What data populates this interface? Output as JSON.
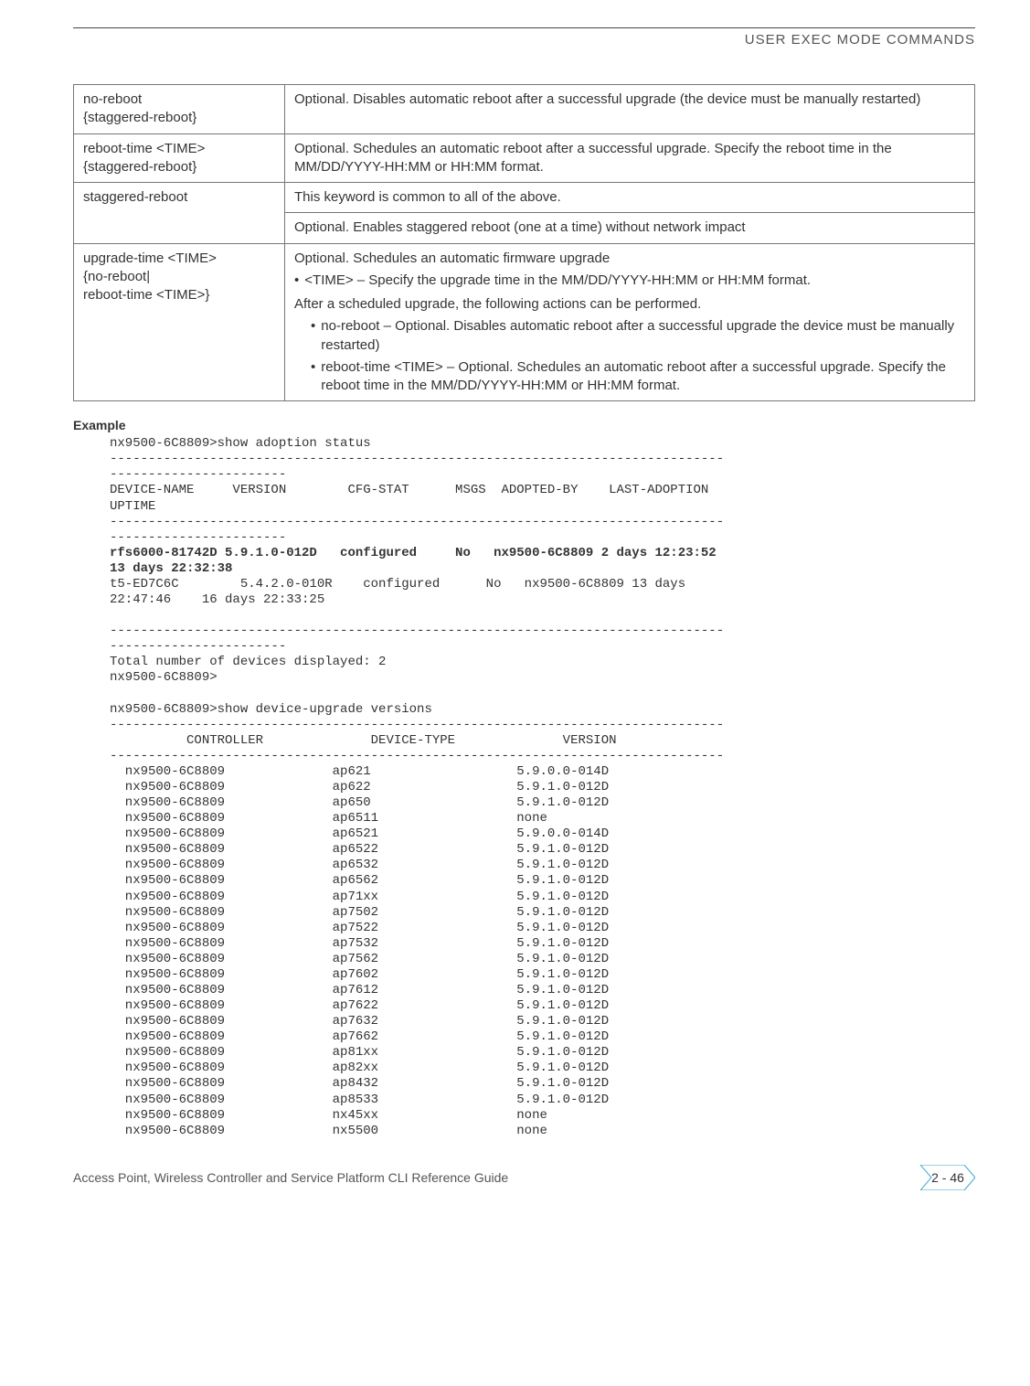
{
  "header": {
    "title": "USER EXEC MODE COMMANDS"
  },
  "table": {
    "rows": [
      {
        "param_line1": "no-reboot",
        "param_line2": "{staggered-reboot}",
        "desc": "Optional. Disables automatic reboot after a successful upgrade (the device must be manually restarted)"
      },
      {
        "param_line1": "reboot-time <TIME>",
        "param_line2": "{staggered-reboot}",
        "desc": "Optional. Schedules an automatic reboot after a successful upgrade. Specify the reboot time in the MM/DD/YYYY-HH:MM or HH:MM format."
      },
      {
        "param_line1": "staggered-reboot",
        "param_line2": "",
        "desc_a": "This keyword is common to all of the above.",
        "desc_b": "Optional. Enables staggered reboot (one at a time) without network impact"
      },
      {
        "param_line1": "upgrade-time <TIME>",
        "param_line2": "{no-reboot|",
        "param_line3": "reboot-time <TIME>}",
        "desc_intro1": "Optional. Schedules an automatic firmware upgrade",
        "bullet1": "<TIME> – Specify the upgrade time in the MM/DD/YYYY-HH:MM or HH:MM format.",
        "desc_intro2": "After a scheduled upgrade, the following actions can be performed.",
        "sub_bullet1": "no-reboot – Optional. Disables automatic reboot after a successful upgrade the device must be manually restarted)",
        "sub_bullet2": "reboot-time <TIME> – Optional. Schedules an automatic reboot after a successful upgrade. Specify the reboot time in the MM/DD/YYYY-HH:MM or HH:MM format."
      }
    ]
  },
  "example_label": "Example",
  "cli": {
    "line01": "nx9500-6C8809>show adoption status",
    "line02": "--------------------------------------------------------------------------------",
    "line03": "-----------------------",
    "line04": "DEVICE-NAME     VERSION        CFG-STAT      MSGS  ADOPTED-BY    LAST-ADOPTION",
    "line05": "UPTIME",
    "line06": "--------------------------------------------------------------------------------",
    "line07": "-----------------------",
    "line08_bold": "rfs6000-81742D 5.9.1.0-012D   configured     No   nx9500-6C8809 2 days 12:23:52",
    "line09_bold": "13 days 22:32:38",
    "line10": "t5-ED7C6C        5.4.2.0-010R    configured      No   nx9500-6C8809 13 days",
    "line11": "22:47:46    16 days 22:33:25",
    "line12": "",
    "line13": "--------------------------------------------------------------------------------",
    "line14": "-----------------------",
    "line15": "Total number of devices displayed: 2",
    "line16": "nx9500-6C8809>",
    "line17": "",
    "line18": "nx9500-6C8809>show device-upgrade versions",
    "line19": "--------------------------------------------------------------------------------",
    "line20": "          CONTROLLER              DEVICE-TYPE              VERSION",
    "line21": "--------------------------------------------------------------------------------",
    "rows": [
      "  nx9500-6C8809              ap621                   5.9.0.0-014D",
      "  nx9500-6C8809              ap622                   5.9.1.0-012D",
      "  nx9500-6C8809              ap650                   5.9.1.0-012D",
      "  nx9500-6C8809              ap6511                  none",
      "  nx9500-6C8809              ap6521                  5.9.0.0-014D",
      "  nx9500-6C8809              ap6522                  5.9.1.0-012D",
      "  nx9500-6C8809              ap6532                  5.9.1.0-012D",
      "  nx9500-6C8809              ap6562                  5.9.1.0-012D",
      "  nx9500-6C8809              ap71xx                  5.9.1.0-012D",
      "  nx9500-6C8809              ap7502                  5.9.1.0-012D",
      "  nx9500-6C8809              ap7522                  5.9.1.0-012D",
      "  nx9500-6C8809              ap7532                  5.9.1.0-012D",
      "  nx9500-6C8809              ap7562                  5.9.1.0-012D",
      "  nx9500-6C8809              ap7602                  5.9.1.0-012D",
      "  nx9500-6C8809              ap7612                  5.9.1.0-012D",
      "  nx9500-6C8809              ap7622                  5.9.1.0-012D",
      "  nx9500-6C8809              ap7632                  5.9.1.0-012D",
      "  nx9500-6C8809              ap7662                  5.9.1.0-012D",
      "  nx9500-6C8809              ap81xx                  5.9.1.0-012D",
      "  nx9500-6C8809              ap82xx                  5.9.1.0-012D",
      "  nx9500-6C8809              ap8432                  5.9.1.0-012D",
      "  nx9500-6C8809              ap8533                  5.9.1.0-012D",
      "  nx9500-6C8809              nx45xx                  none",
      "  nx9500-6C8809              nx5500                  none"
    ]
  },
  "footer": {
    "left": "Access Point, Wireless Controller and Service Platform CLI Reference Guide",
    "page": "2 - 46"
  }
}
